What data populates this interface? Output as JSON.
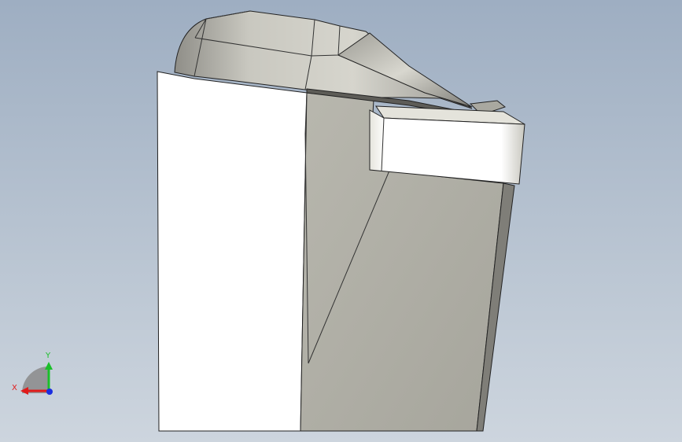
{
  "viewport": {
    "background_top": "#9eaec2",
    "background_bottom": "#cdd5de"
  },
  "model": {
    "face_white": "#ffffff",
    "face_gray": "#b3b2a8",
    "face_dark": "#8c8b85",
    "edge": "#222222"
  },
  "triad": {
    "x_label": "X",
    "y_label": "Y",
    "x_color": "#e01b1b",
    "y_color": "#1bbf2a",
    "z_color": "#1b2ee0"
  }
}
